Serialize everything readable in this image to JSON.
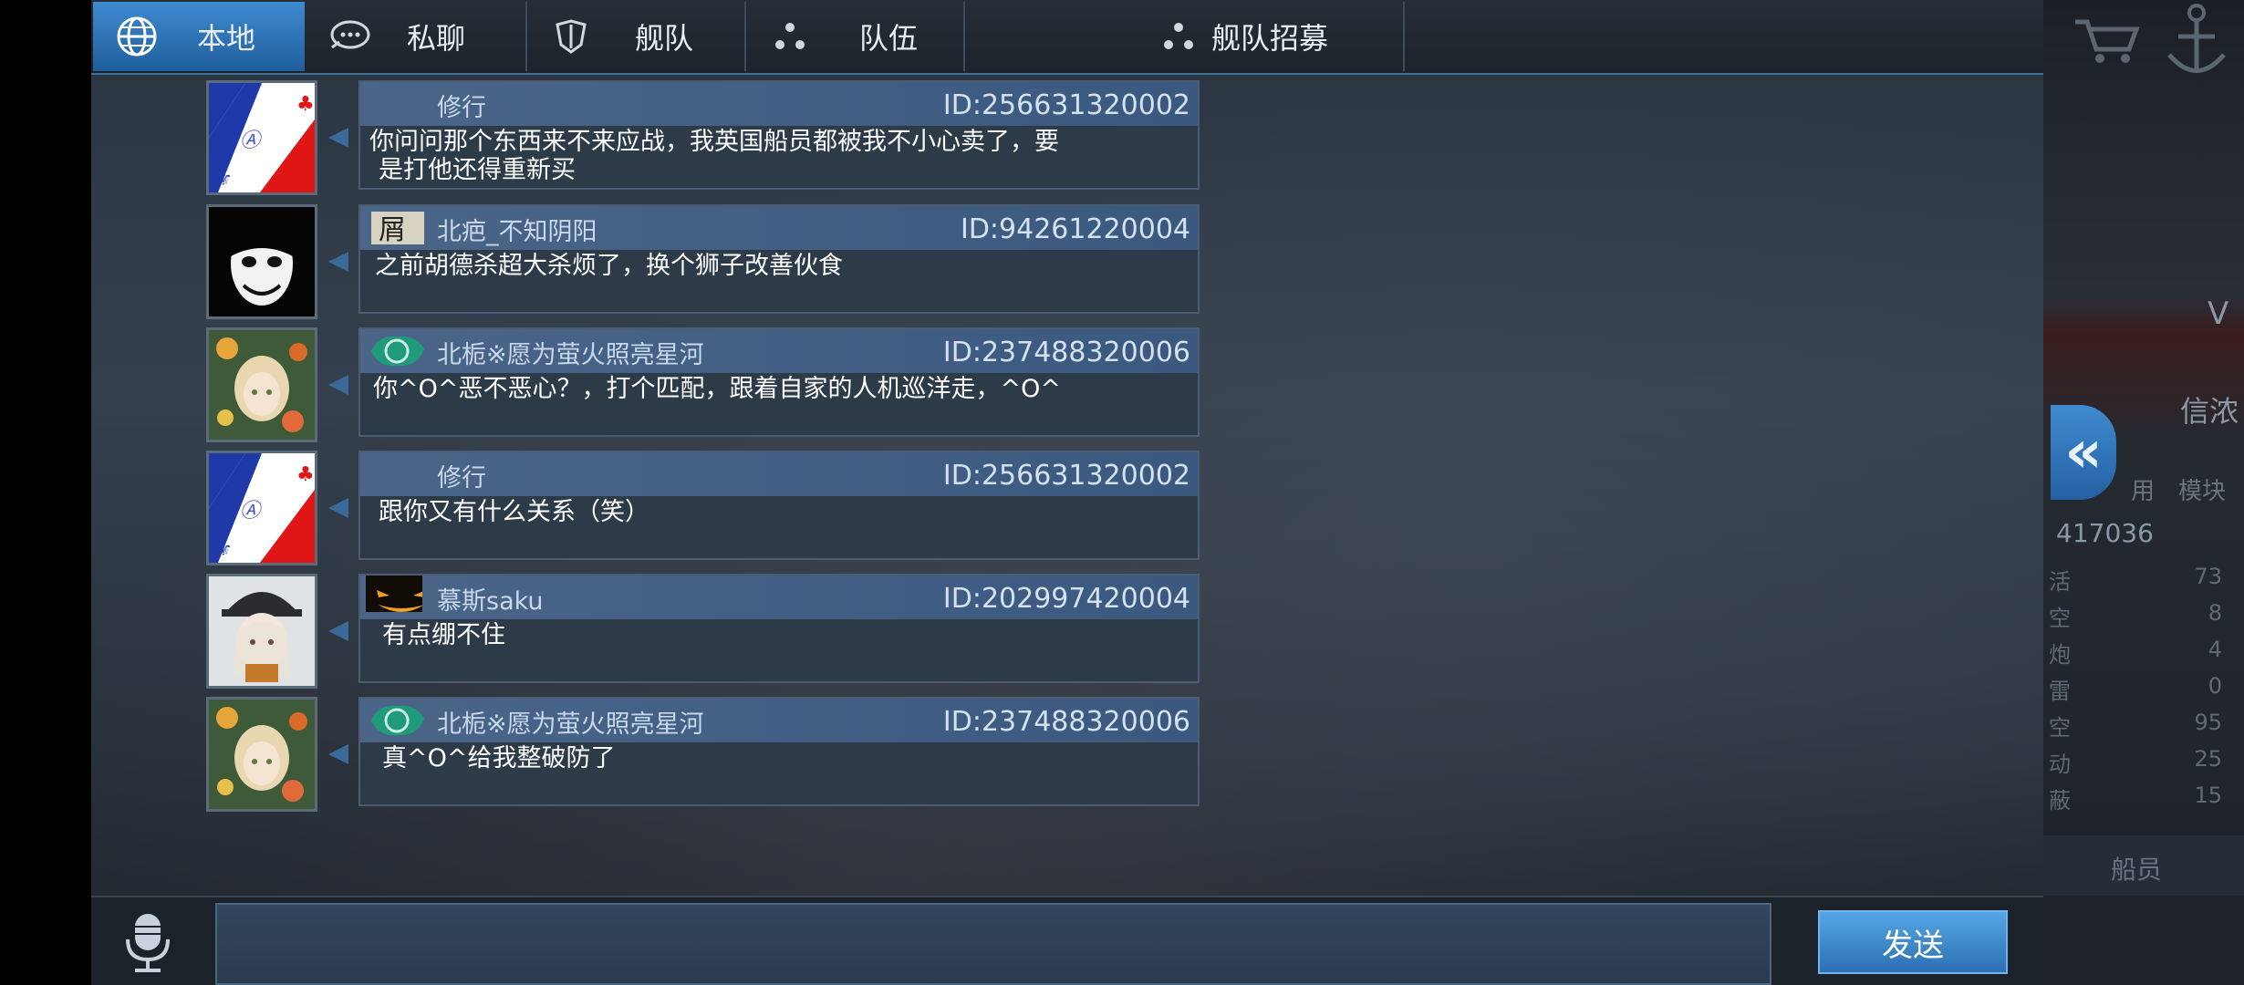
{
  "tabs": [
    {
      "label": "本地",
      "icon": "globe-icon"
    },
    {
      "label": "私聊",
      "icon": "chat-bubble-icon"
    },
    {
      "label": "舰队",
      "icon": "fleet-emblem-icon"
    },
    {
      "label": "队伍",
      "icon": "team-icon"
    },
    {
      "label": "舰队招募",
      "icon": "team-icon"
    }
  ],
  "messages": [
    {
      "name": "修行",
      "uid": "ID:256631320002",
      "text_lines": [
        "你问问那个东西来不来应战，我英国船员都被我不小心卖了，要",
        " 是打他还得重新买"
      ],
      "avatar": "french-flag"
    },
    {
      "name": "北疤_不知阴阳",
      "uid": "ID:94261220004",
      "text_lines": [
        "之前胡德杀超大杀烦了，换个狮子改善伙食"
      ],
      "avatar": "pale-face"
    },
    {
      "name": "北栀※愿为萤火照亮星河",
      "uid": "ID:237488320006",
      "text_lines": [
        "你^O^恶不恶心？，打个匹配，跟着自家的人机巡洋走，^O^"
      ],
      "avatar": "anime-girl-flowers"
    },
    {
      "name": "修行",
      "uid": "ID:256631320002",
      "text_lines": [
        "跟你又有什么关系（笑）"
      ],
      "avatar": "french-flag"
    },
    {
      "name": "慕斯saku",
      "uid": "ID:202997420004",
      "text_lines": [
        "有点绷不住"
      ],
      "avatar": "anime-girl-cap"
    },
    {
      "name": "北栀※愿为萤火照亮星河",
      "uid": "ID:237488320006",
      "text_lines": [
        "真^O^给我整破防了"
      ],
      "avatar": "anime-girl-flowers"
    }
  ],
  "input": {
    "placeholder": "",
    "send_label": "发送"
  },
  "side_panel": {
    "ship_label_v": "V",
    "ship_name_partial": "信浓",
    "btn_partial_1": "用",
    "btn_partial_2": "模块",
    "exp_value": "417036",
    "stats": [
      {
        "key": "活",
        "value": "73"
      },
      {
        "key": "空",
        "value": "8"
      },
      {
        "key": "炮",
        "value": "4"
      },
      {
        "key": "雷",
        "value": "0"
      },
      {
        "key": "空",
        "value": "95"
      },
      {
        "key": "动",
        "value": "25"
      },
      {
        "key": "蔽",
        "value": "15"
      }
    ],
    "crew_label": "船员"
  }
}
